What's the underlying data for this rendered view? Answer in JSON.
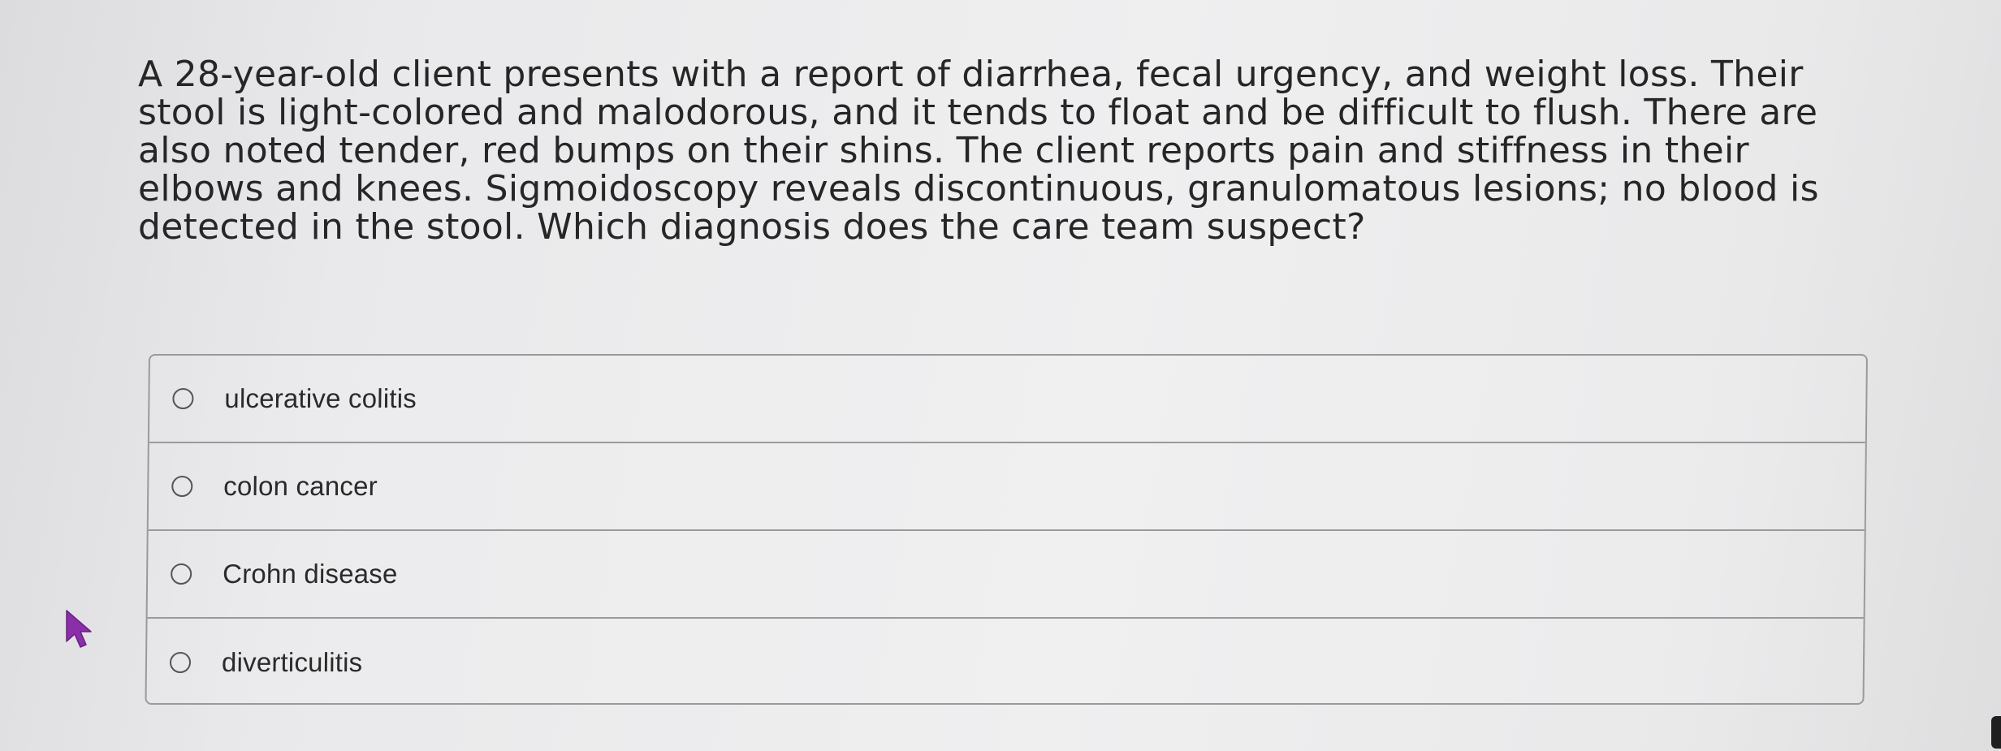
{
  "question": {
    "text": "A 28-year-old client presents with a report of diarrhea, fecal urgency, and weight loss. Their stool is light-colored and malodorous, and it tends to float and be difficult to flush. There are also noted tender, red bumps on their shins. The client reports pain and stiffness in their elbows and knees. Sigmoidoscopy reveals discontinuous, granulomatous lesions; no blood is detected in the stool. Which diagnosis does the care team suspect?"
  },
  "options": [
    {
      "label": "ulcerative colitis",
      "selected": false
    },
    {
      "label": "colon cancer",
      "selected": false
    },
    {
      "label": "Crohn disease",
      "selected": false
    },
    {
      "label": "diverticulitis",
      "selected": false
    }
  ],
  "colors": {
    "cursor": "#8a2fa8",
    "border": "#9a9a9a",
    "text": "#262626"
  },
  "icons": {
    "pointer": "mouse-pointer-icon",
    "radio": "radio-circle-icon"
  }
}
